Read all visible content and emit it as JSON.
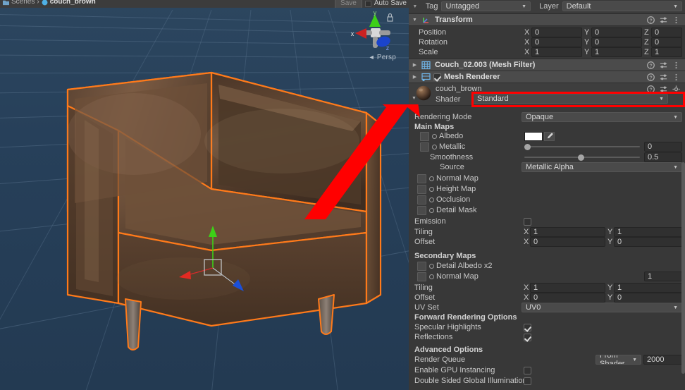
{
  "scene": {
    "breadcrumb": {
      "scenes_label": "Scenes",
      "separator": "›",
      "scene_name": "couch_brown",
      "scene_icon": "unity-scene-icon"
    },
    "save_button": "Save",
    "autosave_label": "Auto Save",
    "projection_label": "Persp",
    "gizmo_axes": {
      "x": "x",
      "y": "y",
      "z": "z"
    },
    "selection_outline_color": "#ff7a1a",
    "background_color": "#27405a",
    "object_color": "#6b4a37"
  },
  "annotation": {
    "arrow_color": "#ff0000",
    "highlight_color": "#ff0000",
    "highlight_target": "shader-dropdown"
  },
  "inspector": {
    "tag": {
      "label": "Tag",
      "value": "Untagged"
    },
    "layer": {
      "label": "Layer",
      "value": "Default"
    },
    "transform": {
      "title": "Transform",
      "rows": [
        {
          "label": "Position",
          "x": "0",
          "y": "0",
          "z": "0"
        },
        {
          "label": "Rotation",
          "x": "0",
          "y": "0",
          "z": "0"
        },
        {
          "label": "Scale",
          "x": "1",
          "y": "1",
          "z": "1"
        }
      ],
      "axis_labels": {
        "x": "X",
        "y": "Y",
        "z": "Z"
      }
    },
    "mesh_filter": {
      "title": "Couch_02.003 (Mesh Filter)"
    },
    "mesh_renderer": {
      "title": "Mesh Renderer",
      "enabled": true
    },
    "material": {
      "name": "couch_brown",
      "shader_label": "Shader",
      "shader_value": "Standard",
      "rendering_mode": {
        "label": "Rendering Mode",
        "value": "Opaque"
      },
      "main_maps_header": "Main Maps",
      "albedo": {
        "label": "Albedo",
        "color": "#ffffff"
      },
      "metallic": {
        "label": "Metallic",
        "value": "0",
        "slider_pct": 0
      },
      "smoothness": {
        "label": "Smoothness",
        "value": "0.5",
        "slider_pct": 50
      },
      "source": {
        "label": "Source",
        "value": "Metallic Alpha"
      },
      "normal_map": {
        "label": "Normal Map"
      },
      "height_map": {
        "label": "Height Map"
      },
      "occlusion": {
        "label": "Occlusion"
      },
      "detail_mask": {
        "label": "Detail Mask"
      },
      "emission": {
        "label": "Emission",
        "checked": false
      },
      "tiling": {
        "label": "Tiling",
        "x": "1",
        "y": "1"
      },
      "offset": {
        "label": "Offset",
        "x": "0",
        "y": "0"
      },
      "secondary_maps_header": "Secondary Maps",
      "detail_albedo": {
        "label": "Detail Albedo x2"
      },
      "secondary_normal_map": {
        "label": "Normal Map",
        "value": "1"
      },
      "tiling2": {
        "label": "Tiling",
        "x": "1",
        "y": "1"
      },
      "offset2": {
        "label": "Offset",
        "x": "0",
        "y": "0"
      },
      "uv_set": {
        "label": "UV Set",
        "value": "UV0"
      },
      "forward_rendering_header": "Forward Rendering Options",
      "specular_highlights": {
        "label": "Specular Highlights",
        "checked": true
      },
      "reflections": {
        "label": "Reflections",
        "checked": true
      },
      "advanced_header": "Advanced Options",
      "render_queue": {
        "label": "Render Queue",
        "mode": "From Shader",
        "value": "2000"
      },
      "gpu_instancing": {
        "label": "Enable GPU Instancing",
        "checked": false
      },
      "double_sided_gi": {
        "label": "Double Sided Global Illumination",
        "checked": false
      }
    },
    "axis_x": "X",
    "axis_y": "Y"
  }
}
